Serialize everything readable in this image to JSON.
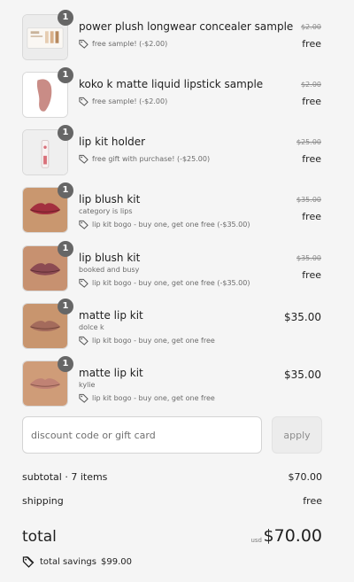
{
  "items": [
    {
      "qty": "1",
      "name": "power plush longwear concealer sample",
      "variant": "",
      "discount": "free sample! (-$2.00)",
      "original_price": "$2.00",
      "price": "free"
    },
    {
      "qty": "1",
      "name": "koko k matte liquid lipstick sample",
      "variant": "",
      "discount": "free sample! (-$2.00)",
      "original_price": "$2.00",
      "price": "free"
    },
    {
      "qty": "1",
      "name": "lip kit holder",
      "variant": "",
      "discount": "free gift with purchase! (-$25.00)",
      "original_price": "$25.00",
      "price": "free"
    },
    {
      "qty": "1",
      "name": "lip blush kit",
      "variant": "category is lips",
      "discount": "lip kit bogo - buy one, get one free (-$35.00)",
      "original_price": "$35.00",
      "price": "free"
    },
    {
      "qty": "1",
      "name": "lip blush kit",
      "variant": "booked and busy",
      "discount": "lip kit bogo - buy one, get one free (-$35.00)",
      "original_price": "$35.00",
      "price": "free"
    },
    {
      "qty": "1",
      "name": "matte lip kit",
      "variant": "dolce k",
      "discount": "lip kit bogo - buy one, get one free",
      "original_price": "",
      "price": "$35.00"
    },
    {
      "qty": "1",
      "name": "matte lip kit",
      "variant": "kylie",
      "discount": "lip kit bogo - buy one, get one free",
      "original_price": "",
      "price": "$35.00"
    }
  ],
  "discount": {
    "placeholder": "discount code or gift card",
    "apply_label": "apply"
  },
  "summary": {
    "subtotal_label": "subtotal · 7 items",
    "subtotal_value": "$70.00",
    "shipping_label": "shipping",
    "shipping_value": "free",
    "total_label": "total",
    "currency": "usd",
    "total_value": "$70.00",
    "savings_label": "total savings",
    "savings_value": "$99.00"
  },
  "colors": {
    "badge": "#666666",
    "text": "#1f1f1f",
    "muted": "#6b6b6b",
    "background": "#f5f5f5"
  }
}
